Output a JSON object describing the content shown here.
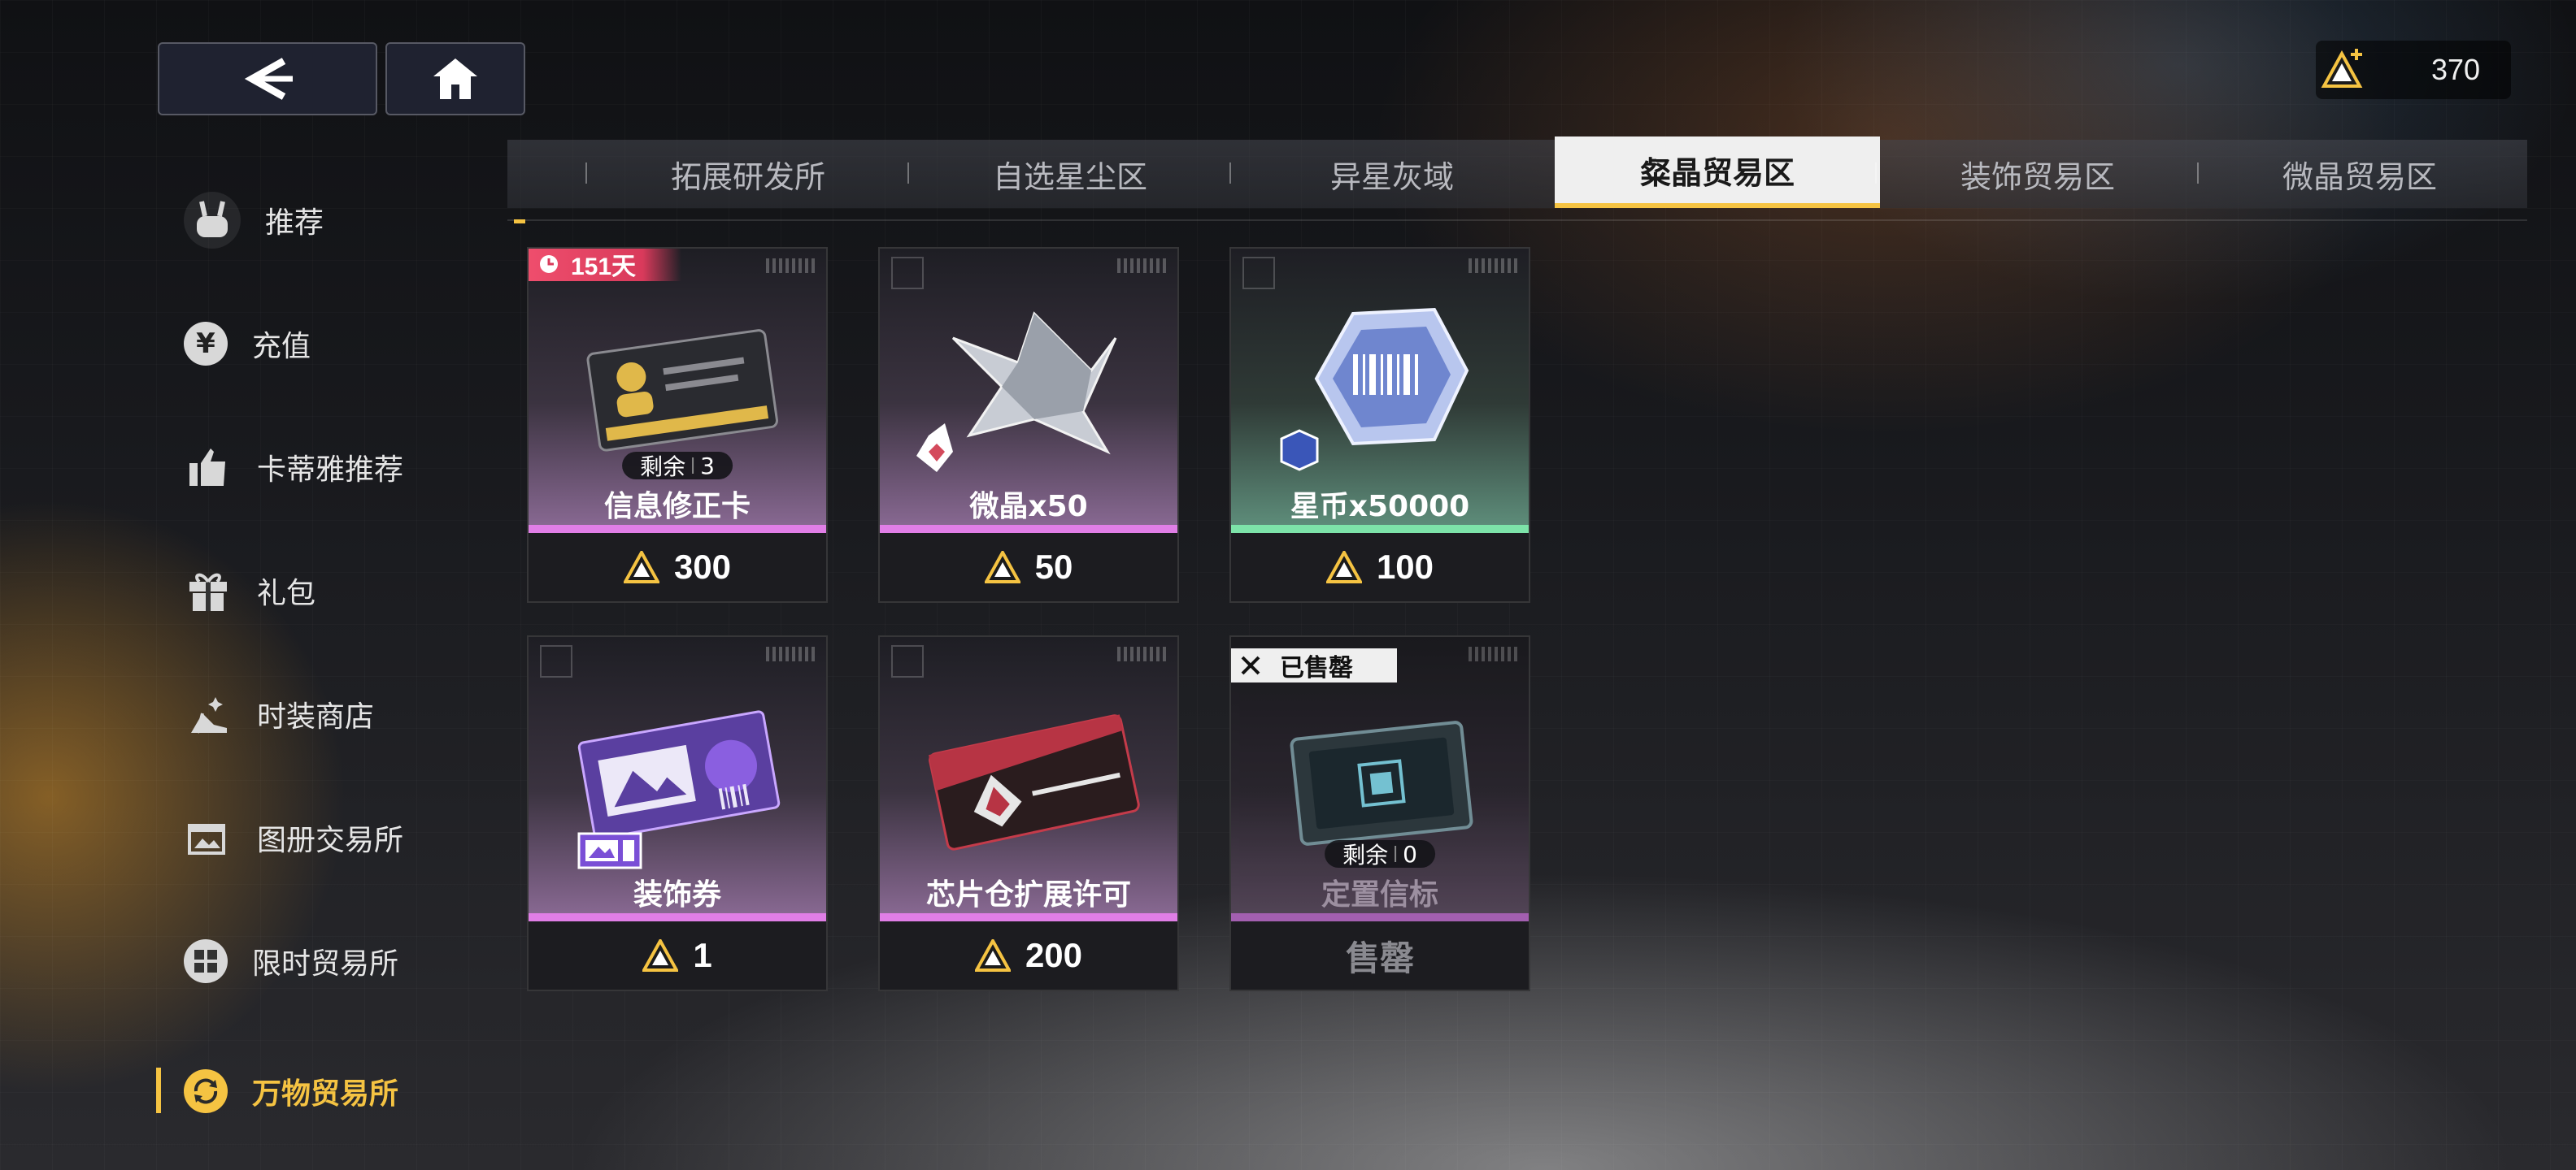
{
  "currency": {
    "icon": "triangle-crystal-icon",
    "value": "370"
  },
  "sidebar": {
    "items": [
      {
        "label": "推荐",
        "icon": "rabbit-icon"
      },
      {
        "label": "充值",
        "icon": "yen-icon"
      },
      {
        "label": "卡蒂雅推荐",
        "icon": "thumbs-up-icon"
      },
      {
        "label": "礼包",
        "icon": "gift-icon"
      },
      {
        "label": "时装商店",
        "icon": "high-heel-icon"
      },
      {
        "label": "图册交易所",
        "icon": "album-icon"
      },
      {
        "label": "限时贸易所",
        "icon": "grid-icon"
      },
      {
        "label": "万物贸易所",
        "icon": "exchange-icon",
        "active": true
      }
    ]
  },
  "tabs": [
    {
      "label": "拓展研发所"
    },
    {
      "label": "自选星尘区"
    },
    {
      "label": "异星灰域"
    },
    {
      "label": "粲晶贸易区",
      "active": true
    },
    {
      "label": "装饰贸易区"
    },
    {
      "label": "微晶贸易区"
    }
  ],
  "items": [
    {
      "name": "信息修正卡",
      "price": "300",
      "remaining_label": "剩余",
      "remaining": "3",
      "timer": "151天",
      "rarity": "purple"
    },
    {
      "name": "微晶x50",
      "price": "50",
      "rarity": "purple"
    },
    {
      "name": "星币x50000",
      "price": "100",
      "rarity": "green"
    },
    {
      "name": "装饰券",
      "price": "1",
      "rarity": "purple"
    },
    {
      "name": "芯片仓扩展许可",
      "price": "200",
      "rarity": "purple"
    },
    {
      "name": "定置信标",
      "price": "售罄",
      "remaining_label": "剩余",
      "remaining": "0",
      "sold_label": "已售罄",
      "rarity": "purple"
    }
  ],
  "colors": {
    "accent": "#f5c342",
    "rarity_purple": "#e07ee6",
    "rarity_green": "#7de3a9",
    "timer_red": "#ef4e6d"
  }
}
